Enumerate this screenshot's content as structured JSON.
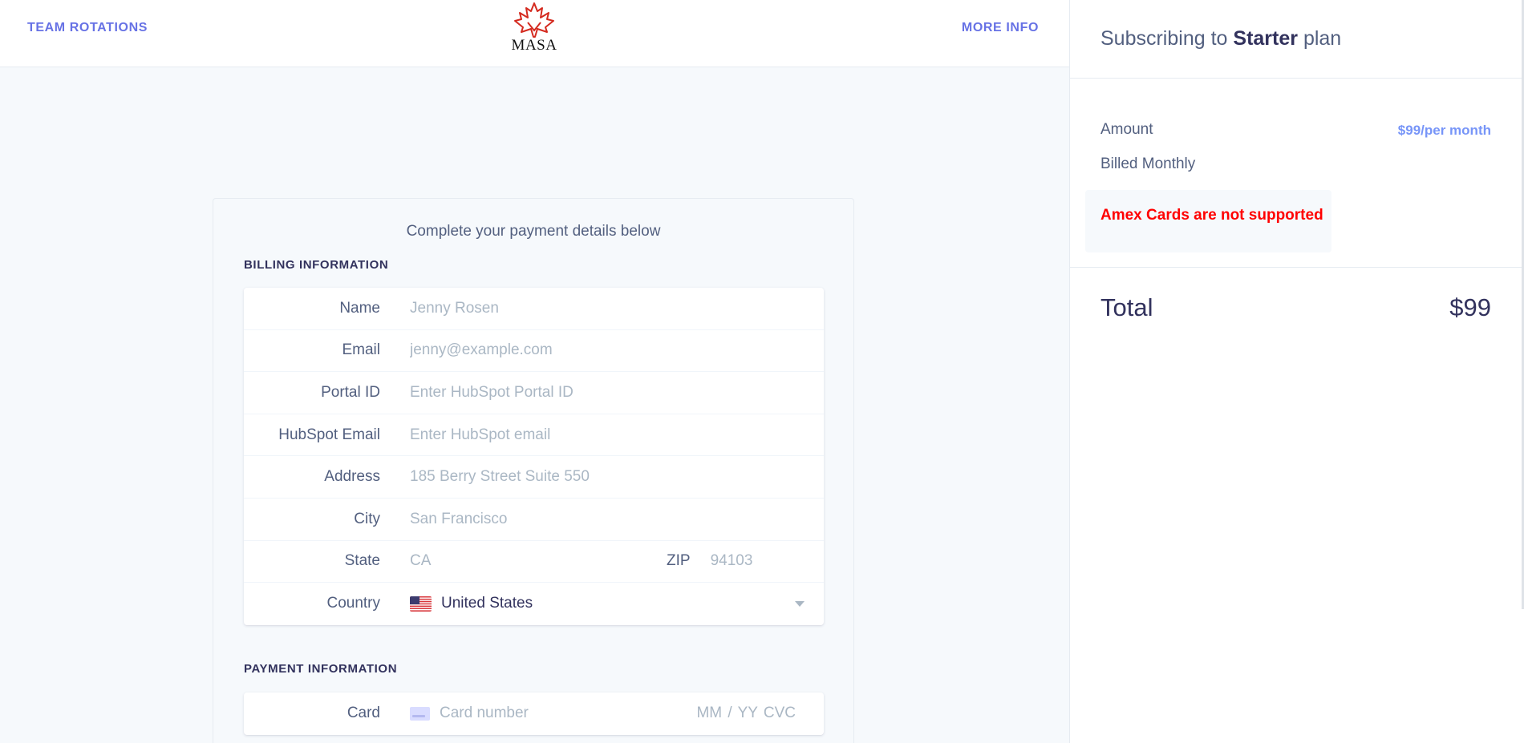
{
  "header": {
    "nav_left": "TEAM ROTATIONS",
    "nav_right": "MORE INFO",
    "logo_text": "MASA"
  },
  "form": {
    "title": "Complete your payment details below",
    "billing_section": "BILLING INFORMATION",
    "fields": {
      "name": {
        "label": "Name",
        "placeholder": "Jenny Rosen"
      },
      "email": {
        "label": "Email",
        "placeholder": "jenny@example.com"
      },
      "portal_id": {
        "label": "Portal ID",
        "placeholder": "Enter HubSpot Portal ID"
      },
      "hubspot_email": {
        "label": "HubSpot Email",
        "placeholder": "Enter HubSpot email"
      },
      "address": {
        "label": "Address",
        "placeholder": "185 Berry Street Suite 550"
      },
      "city": {
        "label": "City",
        "placeholder": "San Francisco"
      },
      "state": {
        "label": "State",
        "placeholder": "CA"
      },
      "zip": {
        "label": "ZIP",
        "placeholder": "94103"
      },
      "country": {
        "label": "Country",
        "value": "United States"
      }
    },
    "payment_section": "PAYMENT INFORMATION",
    "card": {
      "label": "Card",
      "placeholder": "Card number",
      "meta": "MM / YY  CVC"
    }
  },
  "summary": {
    "heading_prefix": "Subscribing to",
    "plan_name": "Starter",
    "heading_suffix": "plan",
    "amount_label": "Amount",
    "amount_value": "$99/per month",
    "billing_cycle": "Billed Monthly",
    "alert": "Amex Cards are not supported",
    "total_label": "Total",
    "total_value": "$99"
  },
  "colors": {
    "accent": "#6772e5",
    "amount": "#7795f8",
    "alert": "#ff0000",
    "logo": "#d42a1f"
  }
}
